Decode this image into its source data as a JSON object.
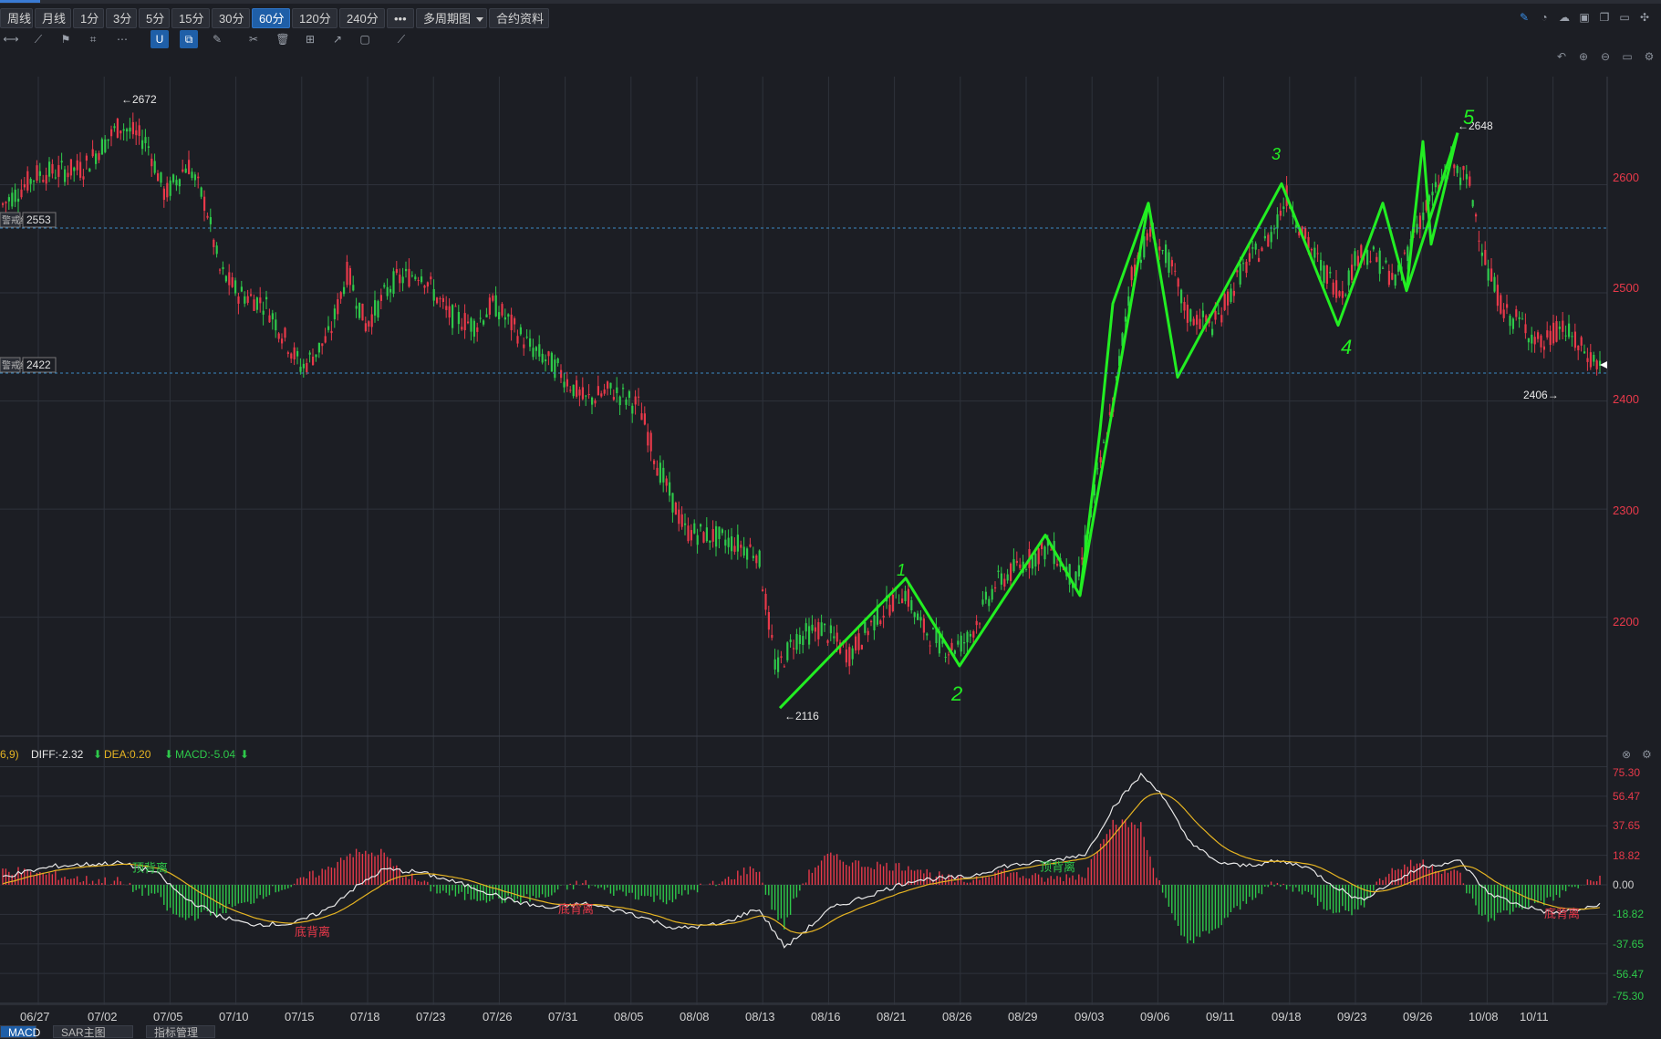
{
  "toolbar": {
    "buttons": [
      "周线",
      "月线",
      "1分",
      "3分",
      "5分",
      "15分",
      "30分",
      "60分",
      "120分",
      "240分",
      "•••",
      "多周期图",
      "合约资料"
    ],
    "active": "60分"
  },
  "main_chart": {
    "price_ticks": [
      "2600",
      "2500",
      "2400",
      "2300",
      "2200"
    ],
    "hlines": [
      {
        "label": "2553",
        "value": 2553,
        "tag": "警戒线"
      },
      {
        "label": "2422",
        "value": 2422,
        "tag": "警戒线"
      }
    ],
    "annotations": [
      {
        "text": "←2672"
      },
      {
        "text": "←2648"
      },
      {
        "text": "2406→"
      },
      {
        "text": "←2116"
      }
    ],
    "wave_labels": [
      "1",
      "2",
      "3",
      "4",
      "5"
    ]
  },
  "x_axis": [
    "06/27",
    "07/02",
    "07/05",
    "07/10",
    "07/15",
    "07/18",
    "07/23",
    "07/26",
    "07/31",
    "08/05",
    "08/08",
    "08/13",
    "08/16",
    "08/21",
    "08/26",
    "08/29",
    "09/03",
    "09/06",
    "09/11",
    "09/18",
    "09/23",
    "09/26",
    "10/08",
    "10/11"
  ],
  "macd": {
    "params": "6,9)",
    "diff": "DIFF:-2.32",
    "dea": "DEA:0.20",
    "macd": "MACD:-5.04",
    "ticks": [
      "75.30",
      "56.47",
      "37.65",
      "18.82",
      "0.00",
      "-18.82",
      "-37.65",
      "-56.47",
      "-75.30"
    ],
    "signals": [
      "顶背离",
      "底背离",
      "底背离",
      "顶背离",
      "底背离"
    ]
  },
  "bottom_tabs": [
    "MACD",
    "SAR主图",
    "指标管理"
  ],
  "colors": {
    "up": "#e8394a",
    "down": "#2ec94a",
    "wave": "#22ee22",
    "diff": "#e8e8e8",
    "dea": "#e6b422",
    "grid": "#2e323b",
    "bg": "#1c1e24"
  },
  "chart_data": {
    "type": "line",
    "title": "",
    "series": [
      {
        "name": "",
        "x": [
          "06/27",
          "07/02",
          "07/05",
          "07/10",
          "07/15",
          "07/18",
          "07/23",
          "07/26",
          "07/31",
          "08/05",
          "08/08",
          "08/13",
          "08/16",
          "08/21",
          "08/26",
          "08/29",
          "09/03",
          "09/06",
          "09/11",
          "09/18",
          "09/23",
          "09/26",
          "10/08",
          "10/11"
        ],
        "values": [
          2590,
          2650,
          2610,
          2500,
          2430,
          2490,
          2510,
          2480,
          2430,
          2410,
          2270,
          2230,
          2170,
          2190,
          2180,
          2230,
          2240,
          2520,
          2510,
          2560,
          2520,
          2560,
          2490,
          2440
        ]
      }
    ],
    "wave_points": [
      2116,
      2236,
      2155,
      2276,
      2220,
      2583,
      2422,
      2601,
      2470,
      2583,
      2502,
      2648
    ],
    "ylim": [
      2090,
      2700
    ]
  }
}
